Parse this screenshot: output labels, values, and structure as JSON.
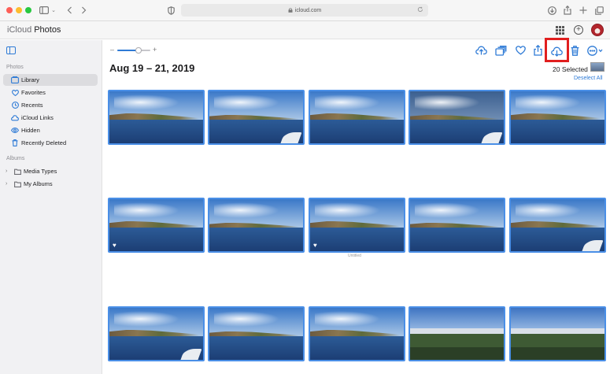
{
  "browser": {
    "url": "icloud.com"
  },
  "app": {
    "apple_glyph": "",
    "brand_icloud": "iCloud",
    "brand_photos": "Photos",
    "avatar": "user-avatar"
  },
  "sidebar": {
    "photos_section": "Photos",
    "albums_section": "Albums",
    "items": [
      {
        "label": "Library",
        "icon": "library-icon",
        "active": true
      },
      {
        "label": "Favorites",
        "icon": "heart-icon"
      },
      {
        "label": "Recents",
        "icon": "clock-icon"
      },
      {
        "label": "iCloud Links",
        "icon": "link-icon"
      },
      {
        "label": "Hidden",
        "icon": "eye-icon"
      },
      {
        "label": "Recently Deleted",
        "icon": "trash-icon"
      }
    ],
    "albums": [
      {
        "label": "Media Types",
        "icon": "folder-icon"
      },
      {
        "label": "My Albums",
        "icon": "folder-icon"
      }
    ]
  },
  "toolbar": {
    "zoom_minus": "–",
    "zoom_plus": "+",
    "zoom_level": 0.65,
    "icons": [
      "upload-icon",
      "add-to-album-icon",
      "favorite-icon",
      "share-icon",
      "download-icon",
      "delete-icon",
      "more-icon"
    ],
    "highlighted_icon": "download-icon"
  },
  "main": {
    "date_range": "Aug 19 – 21, 2019",
    "selected_count": "20 Selected",
    "deselect_all": "Deselect All",
    "untitled_caption": "Untitled"
  },
  "photos": {
    "accent": "#4a8fe7",
    "rows": [
      [
        {
          "scene": "coast"
        },
        {
          "scene": "coast",
          "boat": true
        },
        {
          "scene": "coast"
        },
        {
          "scene": "coast-dark",
          "boat": true
        },
        {
          "scene": "coast"
        }
      ],
      [
        {
          "scene": "coast",
          "favorite": true
        },
        {
          "scene": "coast"
        },
        {
          "scene": "coast",
          "favorite": true
        },
        {
          "scene": "coast"
        },
        {
          "scene": "coast",
          "boat": true
        }
      ],
      [
        {
          "scene": "coast",
          "boat": true
        },
        {
          "scene": "coast"
        },
        {
          "scene": "coast"
        },
        {
          "scene": "aerial"
        },
        {
          "scene": "aerial"
        }
      ]
    ]
  }
}
